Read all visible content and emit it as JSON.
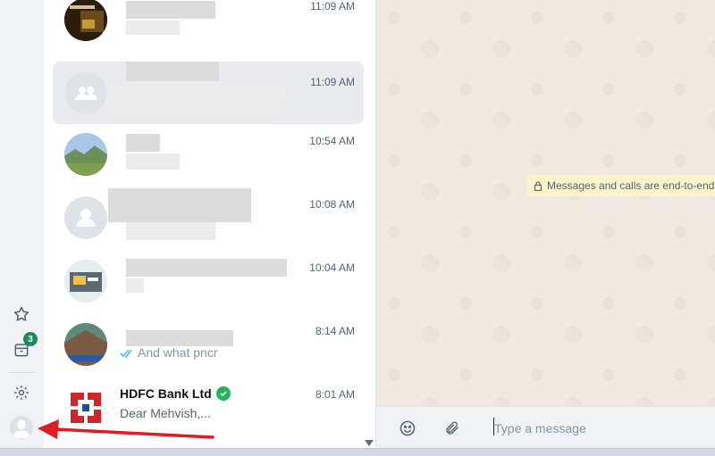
{
  "rail": {
    "archived_badge": "3",
    "icons": [
      "star-icon",
      "archive-icon",
      "settings-icon",
      "profile-avatar"
    ]
  },
  "chats": [
    {
      "time": "11:09 AM"
    },
    {
      "time": "11:09 AM",
      "selected": true
    },
    {
      "time": "10:54 AM"
    },
    {
      "time": "10:08 AM"
    },
    {
      "time": "10:04 AM"
    },
    {
      "time": "8:14 AM",
      "preview": "And what pncr"
    },
    {
      "time": "8:01 AM",
      "name": "HDFC Bank Ltd",
      "preview": "Dear Mehvish,..."
    }
  ],
  "main": {
    "encryption_notice": "Messages and calls are end-to-end encr",
    "composer_placeholder": "Type a message"
  },
  "colors": {
    "accent_green": "#1f8a5a",
    "verified_green": "#21b35a",
    "arrow_red": "#e11b22",
    "notice_bg": "#fcf4cb",
    "hdfc_red": "#d0262a",
    "hdfc_blue": "#1a4f9c"
  }
}
